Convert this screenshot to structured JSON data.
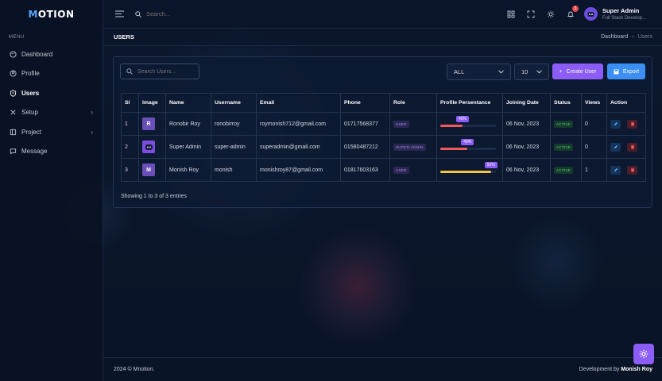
{
  "brand": {
    "logo_prefix": "M",
    "logo_rest": "OTION"
  },
  "sidebar": {
    "menu_label": "MENU",
    "items": [
      {
        "label": "Dashboard",
        "icon": "palette-icon"
      },
      {
        "label": "Profile",
        "icon": "user-circle-icon"
      },
      {
        "label": "Users",
        "icon": "shield-user-icon",
        "active": true
      },
      {
        "label": "Setup",
        "icon": "tools-icon",
        "has_submenu": true
      },
      {
        "label": "Project",
        "icon": "sidebar-layout-icon",
        "has_submenu": true
      },
      {
        "label": "Message",
        "icon": "chat-icon"
      }
    ]
  },
  "topbar": {
    "search_placeholder": "Search...",
    "notification_count": "3",
    "user_name": "Super Admin",
    "user_role": "Full Stack Develop..."
  },
  "page": {
    "title": "USERS",
    "breadcrumb": [
      "Dashboard",
      "Users"
    ]
  },
  "toolbar": {
    "search_placeholder": "Search Users...",
    "filter_value": "ALL",
    "page_size_value": "10",
    "create_label": "Create User",
    "export_label": "Export"
  },
  "table": {
    "headers": [
      "Sl",
      "Image",
      "Name",
      "Username",
      "Email",
      "Phone",
      "Role",
      "Profile Persentance",
      "Joining Date",
      "Status",
      "Views",
      "Action"
    ],
    "rows": [
      {
        "sl": "1",
        "image": "R",
        "name": "Ronobir Roy",
        "username": "ronobirroy",
        "email": "roymonish712@gmail.com",
        "phone": "01717568377",
        "role": "USER",
        "progress": 40,
        "progress_label": "40%",
        "joining": "06 Nov, 2023",
        "status": "ACTIVE",
        "views": "0"
      },
      {
        "sl": "2",
        "image": "avatar",
        "name": "Super Admin",
        "username": "super-admin",
        "email": "superadmin@gmail.com",
        "phone": "01580487212",
        "role": "SUPER-ADMIN",
        "progress": 49,
        "progress_label": "49%",
        "joining": "06 Nov, 2023",
        "status": "ACTIVE",
        "views": "0"
      },
      {
        "sl": "3",
        "image": "M",
        "name": "Monish Roy",
        "username": "monish",
        "email": "monishroy87@gmail.com",
        "phone": "01817603163",
        "role": "USER",
        "progress": 91,
        "progress_label": "91%",
        "joining": "06 Nov, 2023",
        "status": "ACTIVE",
        "views": "1"
      }
    ]
  },
  "showing_text": "Showing 1 to 3 of 3 entries",
  "footer": {
    "copyright": "2024 © Mnotion.",
    "credit_prefix": "Development by",
    "credit_name": "Monish Roy"
  },
  "colors": {
    "accent": "#8b5cf6",
    "export": "#3b8ef2",
    "progress_low": "#ef5a5a",
    "progress_high": "#f4c542"
  }
}
